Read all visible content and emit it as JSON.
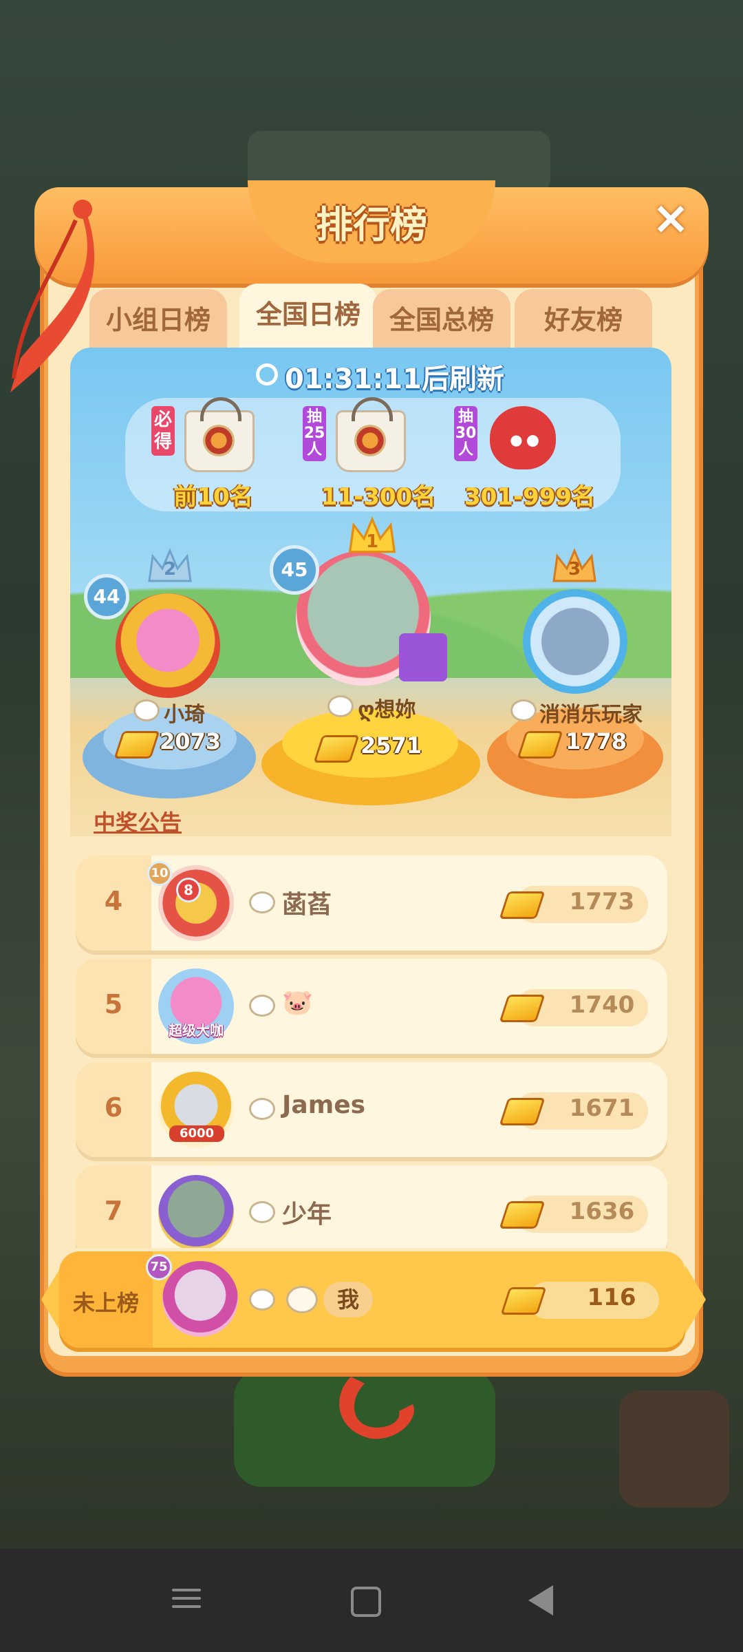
{
  "title": "排行榜",
  "close_label": "×",
  "tabs": [
    {
      "label": "小组日榜",
      "active": false
    },
    {
      "label": "全国日榜",
      "active": true
    },
    {
      "label": "全国总榜",
      "active": false
    },
    {
      "label": "好友榜",
      "active": false
    }
  ],
  "timer": {
    "icon": "clock-icon",
    "text": "01:31:11后刷新"
  },
  "rewards": [
    {
      "tag": "必得",
      "label": "前10名",
      "icon": "gift-bag-icon"
    },
    {
      "tag": "抽25人",
      "label": "11-300名",
      "icon": "gift-bag-icon"
    },
    {
      "tag": "抽30人",
      "label": "301-999名",
      "icon": "red-fox-plush-icon"
    }
  ],
  "podium": [
    {
      "rank": "1",
      "level": "45",
      "name": "ღ想妳",
      "score": "2571"
    },
    {
      "rank": "2",
      "level": "44",
      "name": "小琦",
      "score": "2073"
    },
    {
      "rank": "3",
      "name": "消消乐玩家",
      "score": "1778"
    }
  ],
  "announcement": "中奖公告",
  "rows": [
    {
      "rank": "4",
      "level": "10",
      "badge": "8",
      "name": "菡萏",
      "score": "1773"
    },
    {
      "rank": "5",
      "badge_text": "超级大咖",
      "name": "🐷",
      "score": "1740"
    },
    {
      "rank": "6",
      "badge_text": "6000",
      "name": "James",
      "score": "1671"
    },
    {
      "rank": "7",
      "name": "少年",
      "score": "1636"
    }
  ],
  "me": {
    "rank_label": "未上榜",
    "level": "75",
    "tag": "我",
    "score": "116"
  },
  "colors": {
    "panel": "#f6a44a",
    "inner": "#fde9c0",
    "sky": "#78c7f2",
    "gold": "#ffd23a"
  }
}
